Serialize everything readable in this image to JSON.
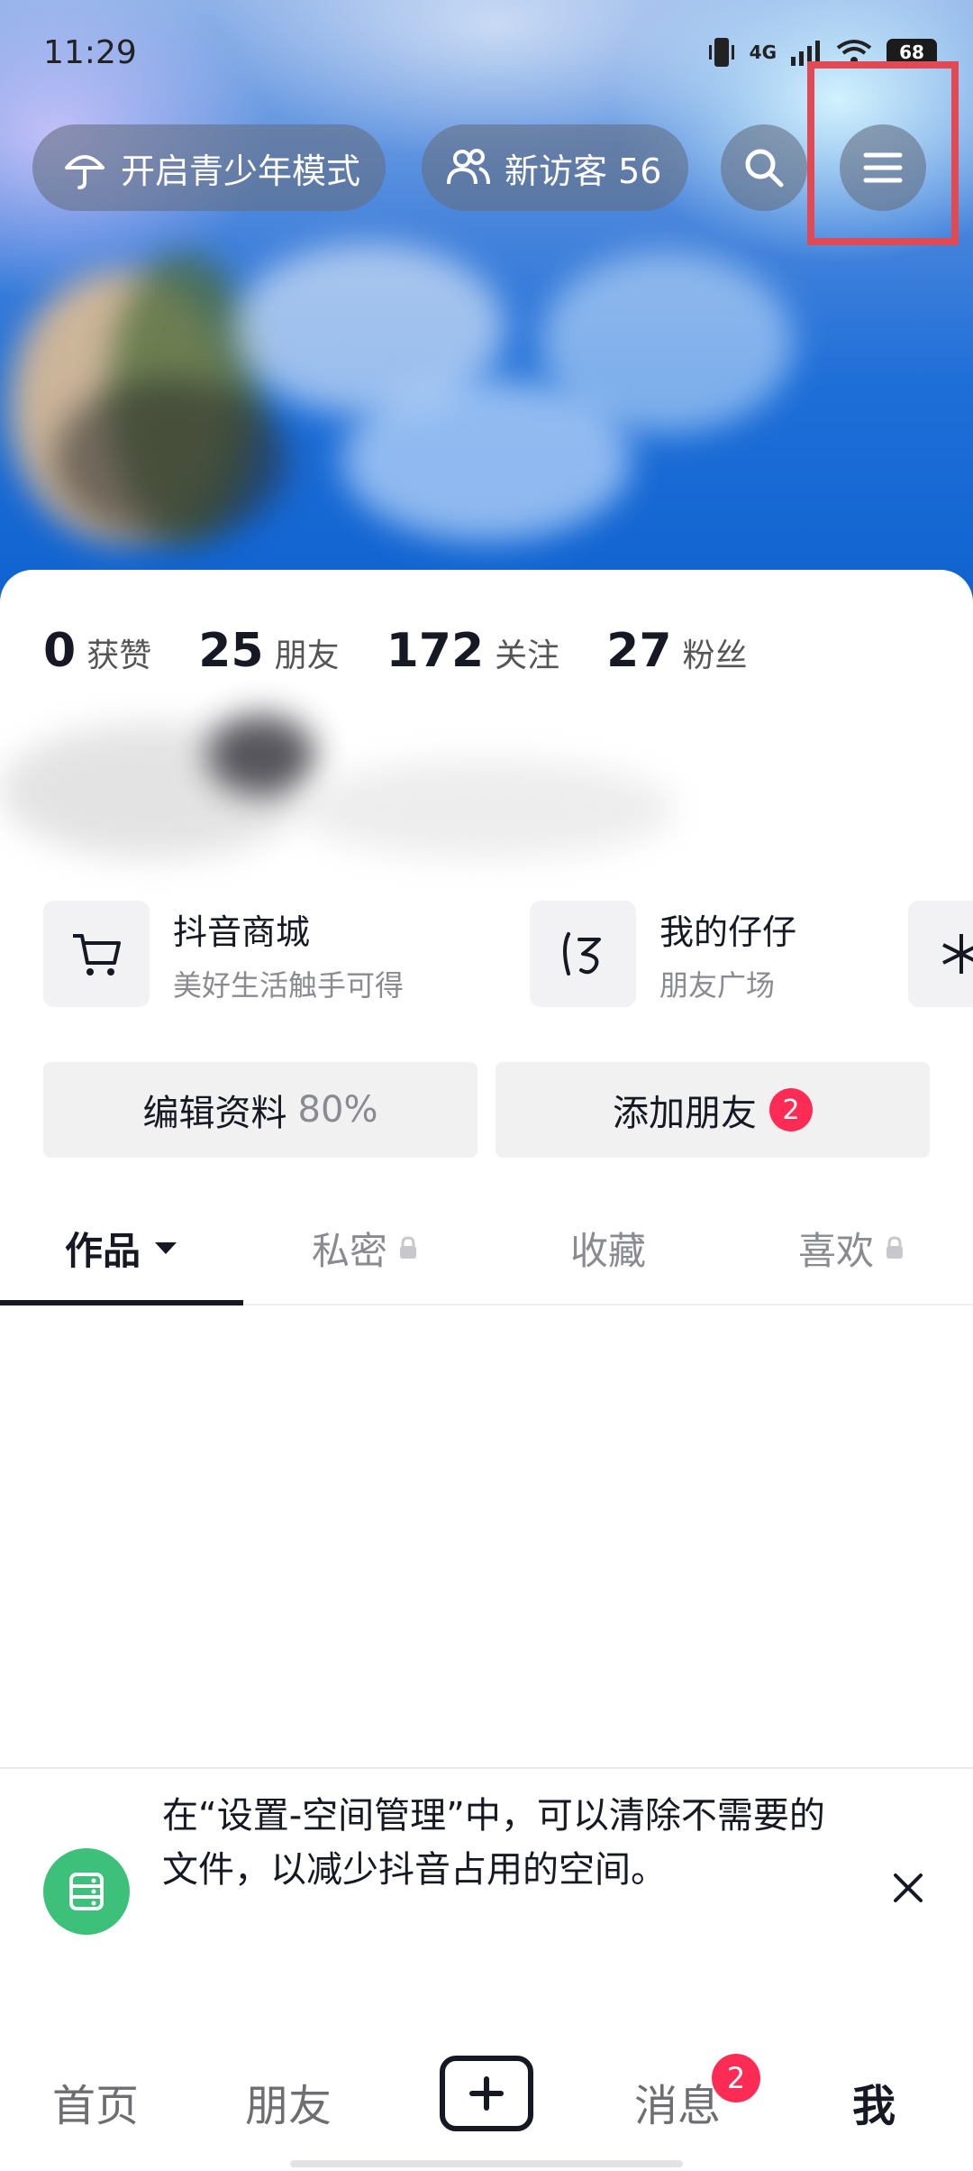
{
  "status_bar": {
    "time": "11:29",
    "network": "4G",
    "battery": "68"
  },
  "header": {
    "teen_mode_label": "开启青少年模式",
    "visitors_label": "新访客 56",
    "icons": [
      "umbrella-icon",
      "people-icon",
      "search-icon",
      "menu-icon"
    ]
  },
  "stats": [
    {
      "value": "0",
      "label": "获赞"
    },
    {
      "value": "25",
      "label": "朋友"
    },
    {
      "value": "172",
      "label": "关注"
    },
    {
      "value": "27",
      "label": "粉丝"
    }
  ],
  "services": [
    {
      "title": "抖音商城",
      "subtitle": "美好生活触手可得",
      "icon": "cart-icon"
    },
    {
      "title": "我的仔仔",
      "subtitle": "朋友广场",
      "icon": "zaizai-icon"
    }
  ],
  "actions": {
    "edit_profile": "编辑资料",
    "edit_progress": "80%",
    "add_friends": "添加朋友",
    "add_friends_badge": "2"
  },
  "tabs": [
    {
      "label": "作品",
      "active": true
    },
    {
      "label": "私密",
      "locked": true
    },
    {
      "label": "收藏"
    },
    {
      "label": "喜欢",
      "locked": true
    }
  ],
  "notice": {
    "text": "在“设置-空间管理”中，可以清除不需要的文件，以减少抖音占用的空间。",
    "icon": "storage-icon"
  },
  "bottom_nav": {
    "home": "首页",
    "friends": "朋友",
    "messages": "消息",
    "messages_badge": "2",
    "me": "我"
  },
  "colors": {
    "accent": "#fe2c55",
    "highlight": "#e04a55",
    "notice_green": "#3dc07a"
  }
}
